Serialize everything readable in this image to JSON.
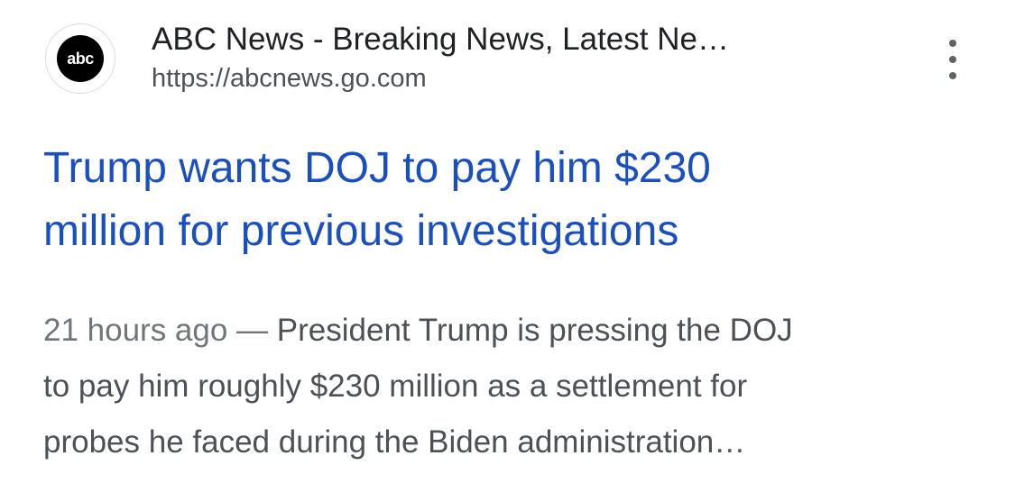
{
  "source": {
    "favicon_text": "abc",
    "site_name": "ABC News - Breaking News, Latest Ne…",
    "url": "https://abcnews.go.com",
    "more_icon": "vertical-ellipsis-icon"
  },
  "result": {
    "headline_line1": "Trump wants DOJ to pay him $230",
    "headline_line2": "million for previous investigations",
    "date": "21 hours ago",
    "separator": " — ",
    "snippet_line1": "President Trump is pressing the DOJ",
    "snippet_line2": "to pay him roughly $230 million as a settlement for",
    "snippet_line3": "probes he faced during the Biden administration…"
  },
  "colors": {
    "link": "#1a4fc2",
    "title": "#202124",
    "secondary": "#4d5156"
  }
}
